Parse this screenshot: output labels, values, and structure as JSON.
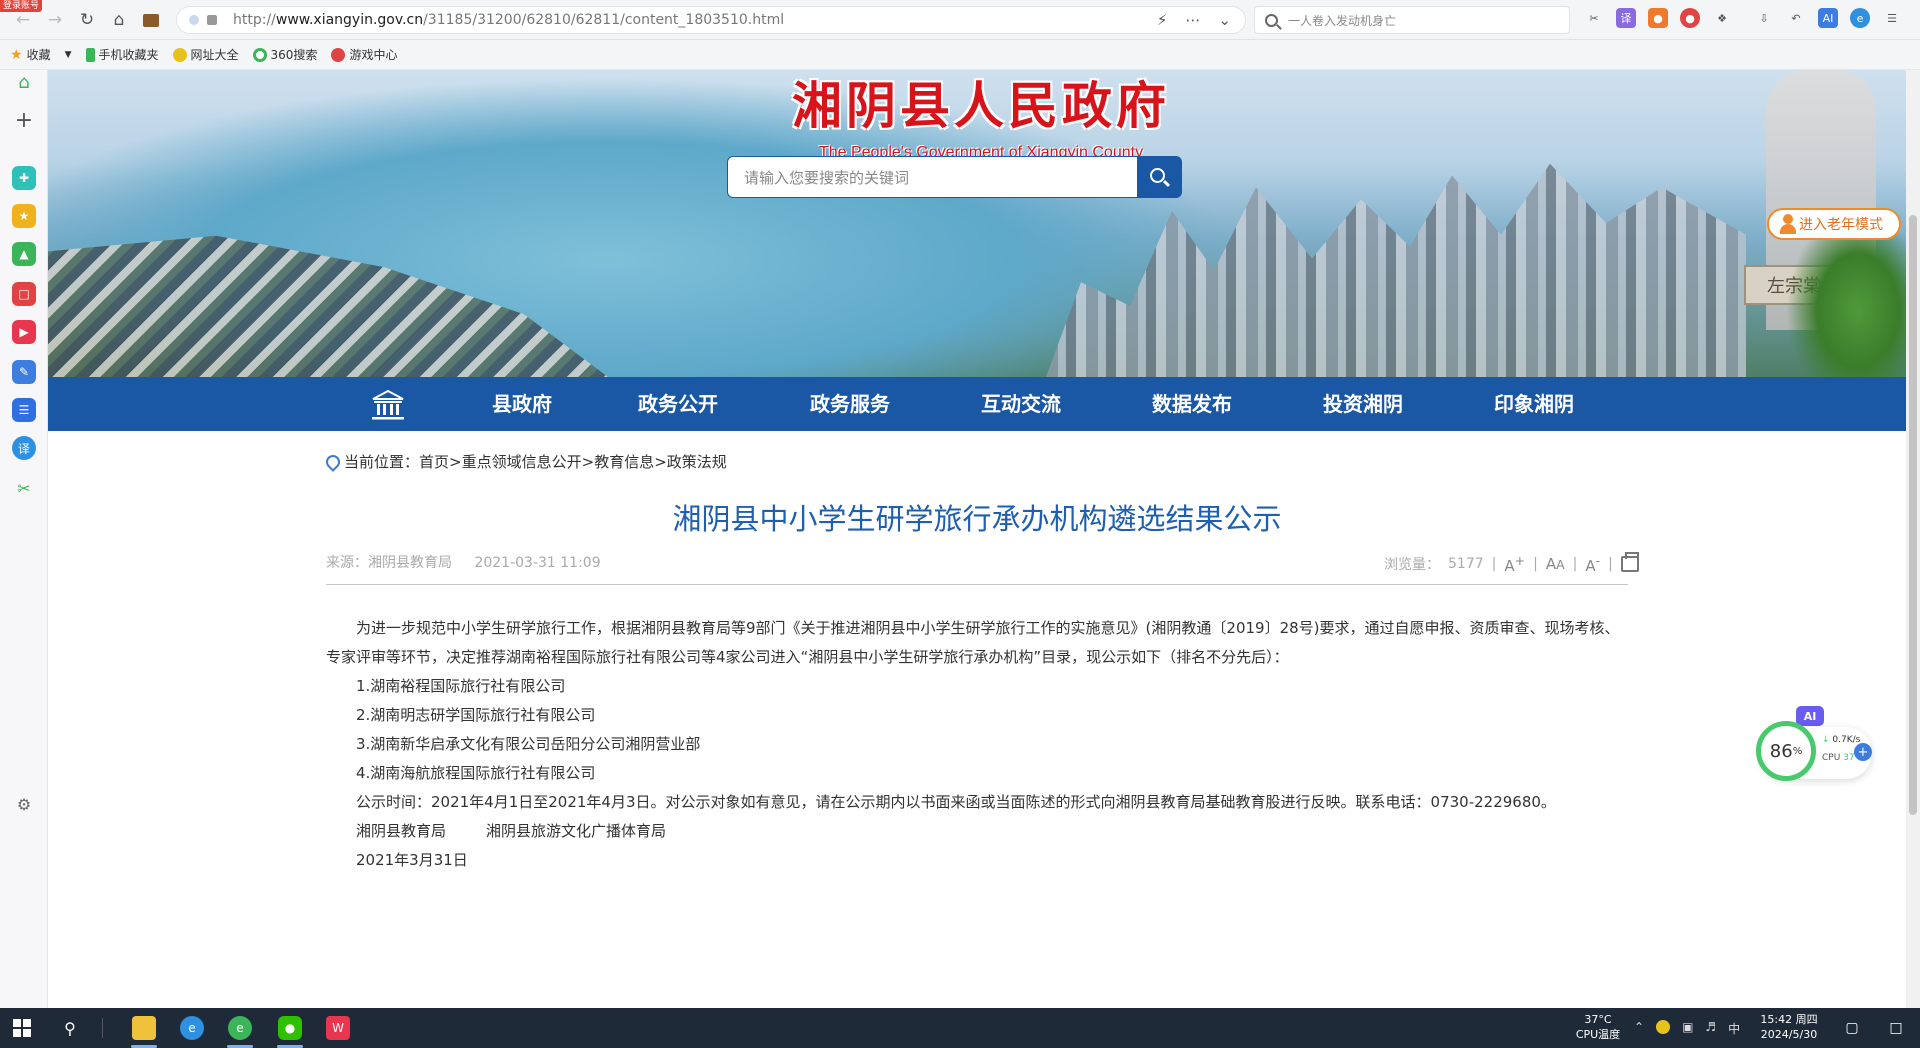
{
  "browser": {
    "badge": "登录账号",
    "url_prefix": "http://",
    "url_domain": "www.xiangyin.gov.cn",
    "url_path": "/31185/31200/62810/62811/content_1803510.html",
    "search_text": "一人卷入发动机身亡"
  },
  "bookmarks": [
    {
      "label": "收藏"
    },
    {
      "label": "手机收藏夹"
    },
    {
      "label": "网址大全"
    },
    {
      "label": "360搜索"
    },
    {
      "label": "游戏中心"
    }
  ],
  "header": {
    "title": "湘阴县人民政府",
    "subtitle": "The People's Government of Xiangyin County",
    "search_placeholder": "请输入您要搜索的关键词",
    "elder_mode": "进入老年模式",
    "plaque": "左宗棠"
  },
  "nav": [
    {
      "label": "县政府"
    },
    {
      "label": "政务公开"
    },
    {
      "label": "政务服务"
    },
    {
      "label": "互动交流"
    },
    {
      "label": "数据发布"
    },
    {
      "label": "投资湘阴"
    },
    {
      "label": "印象湘阴"
    }
  ],
  "breadcrumb": {
    "prefix": "当前位置：",
    "items": [
      "首页",
      "重点领域信息公开",
      "教育信息",
      "政策法规"
    ],
    "separator": ">"
  },
  "article": {
    "title": "湘阴县中小学生研学旅行承办机构遴选结果公示",
    "source": "来源：湘阴县教育局",
    "date": "2021-03-31 11:09",
    "views_label": "浏览量：",
    "views": "5177",
    "intro": "为进一步规范中小学生研学旅行工作，根据湘阴县教育局等9部门《关于推进湘阴县中小学生研学旅行工作的实施意见》(湘阴教通〔2019〕28号)要求，通过自愿申报、资质审查、现场考核、专家评审等环节，决定推荐湖南裕程国际旅行社有限公司等4家公司进入“湘阴县中小学生研学旅行承办机构”目录，现公示如下（排名不分先后）：",
    "items": [
      "1.湖南裕程国际旅行社有限公司",
      "2.湖南明志研学国际旅行社有限公司",
      "3.湖南新华启承文化有限公司岳阳分公司湘阴营业部",
      "4.湖南海航旅程国际旅行社有限公司"
    ],
    "notice": "公示时间：2021年4月1日至2021年4月3日。对公示对象如有意见，请在公示期内以书面来函或当面陈述的形式向湘阴县教育局基础教育股进行反映。联系电话：0730-2229680。",
    "signer1": "湘阴县教育局",
    "signer2": "湘阴县旅游文化广播体育局",
    "sign_date": "2021年3月31日"
  },
  "widget": {
    "ai": "AI",
    "percent": "86",
    "percent_unit": "%",
    "net": "0.7K/s",
    "cpu_label": "CPU",
    "cpu_temp": "37°C"
  },
  "taskbar": {
    "temp": "37°C",
    "temp_label": "CPU温度",
    "ime": "中",
    "time": "15:42 周四",
    "date": "2024/5/30"
  }
}
